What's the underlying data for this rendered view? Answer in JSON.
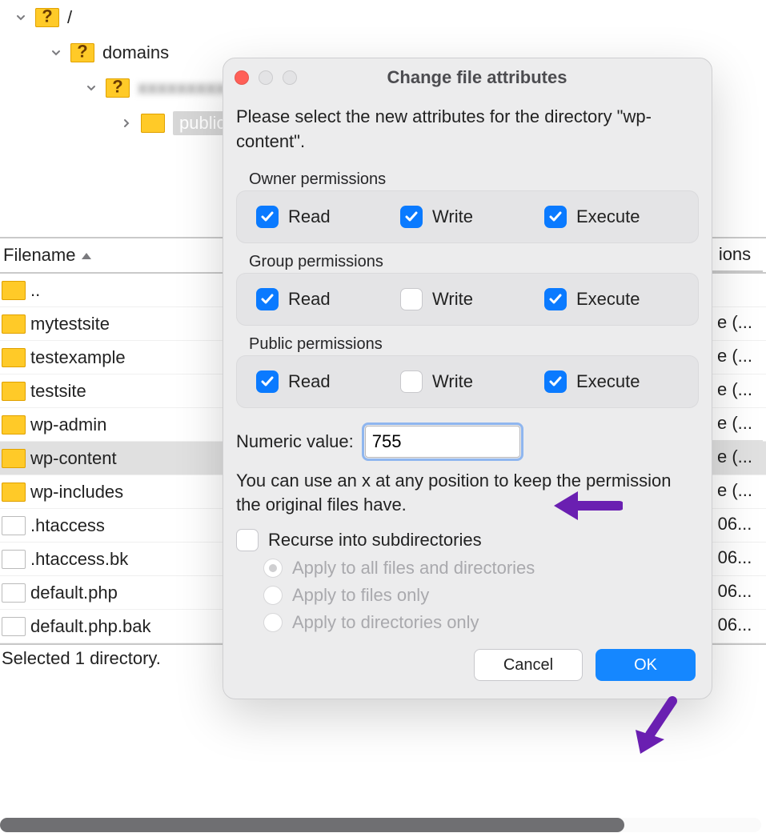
{
  "tree": {
    "root": {
      "label": "/"
    },
    "level1": {
      "label": "domains"
    },
    "level2": {
      "label_blurred": "xxxxxxxxx"
    },
    "level3": {
      "label": "public_h"
    }
  },
  "filelist": {
    "header": {
      "filename": "Filename",
      "right_col": "ions"
    },
    "rows": [
      {
        "name": "..",
        "type": "folder",
        "right": ""
      },
      {
        "name": "mytestsite",
        "type": "folder",
        "right": "e (..."
      },
      {
        "name": "testexample",
        "type": "folder",
        "right": "e (..."
      },
      {
        "name": "testsite",
        "type": "folder",
        "right": "e (..."
      },
      {
        "name": "wp-admin",
        "type": "folder",
        "right": "e (..."
      },
      {
        "name": "wp-content",
        "type": "folder",
        "right": "e (...",
        "selected": true
      },
      {
        "name": "wp-includes",
        "type": "folder",
        "right": "e (..."
      },
      {
        "name": ".htaccess",
        "type": "file",
        "right": "06..."
      },
      {
        "name": ".htaccess.bk",
        "type": "file",
        "right": "06..."
      },
      {
        "name": "default.php",
        "type": "file",
        "right": "06..."
      },
      {
        "name": "default.php.bak",
        "type": "file",
        "right": "06..."
      }
    ],
    "footer": "Selected 1 directory."
  },
  "dialog": {
    "title": "Change file attributes",
    "instruction": "Please select the new attributes for the directory \"wp-content\".",
    "groups": {
      "owner": {
        "label": "Owner permissions",
        "read": true,
        "write": true,
        "execute": true
      },
      "group": {
        "label": "Group permissions",
        "read": true,
        "write": false,
        "execute": true
      },
      "public": {
        "label": "Public permissions",
        "read": true,
        "write": false,
        "execute": true
      }
    },
    "labels": {
      "read": "Read",
      "write": "Write",
      "execute": "Execute"
    },
    "numeric_label": "Numeric value:",
    "numeric_value": "755",
    "hint": "You can use an x at any position to keep the permission the original files have.",
    "recurse_label": "Recurse into subdirectories",
    "recurse_checked": false,
    "radio": {
      "all": "Apply to all files and directories",
      "files": "Apply to files only",
      "dirs": "Apply to directories only"
    },
    "buttons": {
      "cancel": "Cancel",
      "ok": "OK"
    }
  }
}
